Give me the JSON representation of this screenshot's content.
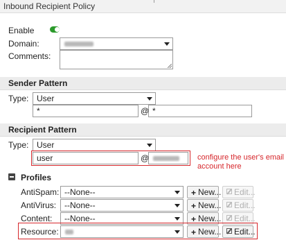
{
  "window": {
    "title": "Inbound Recipient Policy"
  },
  "general": {
    "enable_label": "Enable",
    "enable_value": true,
    "domain_label": "Domain:",
    "comments_label": "Comments:",
    "comments_value": ""
  },
  "sender": {
    "section_title": "Sender Pattern",
    "type_label": "Type:",
    "type_value": "User",
    "local_value": "*",
    "at": "@",
    "domain_value": "*"
  },
  "recipient": {
    "section_title": "Recipient Pattern",
    "type_label": "Type:",
    "type_value": "User",
    "local_value": "user",
    "at": "@",
    "annotation_line1": "configure the user's email",
    "annotation_line2": "account here"
  },
  "profiles": {
    "section_title": "Profiles",
    "new_label": "New...",
    "edit_label": "Edit...",
    "rows": [
      {
        "label": "AntiSpam:",
        "value": "--None--",
        "edit_enabled": false
      },
      {
        "label": "AntiVirus:",
        "value": "--None--",
        "edit_enabled": false
      },
      {
        "label": "Content:",
        "value": "--None--",
        "edit_enabled": false
      },
      {
        "label": "Resource:",
        "value": "",
        "edit_enabled": true
      }
    ]
  },
  "colors": {
    "toggle_on": "#2b9a2b",
    "annotation_red": "#d6262b",
    "section_bg": "#ececec"
  }
}
